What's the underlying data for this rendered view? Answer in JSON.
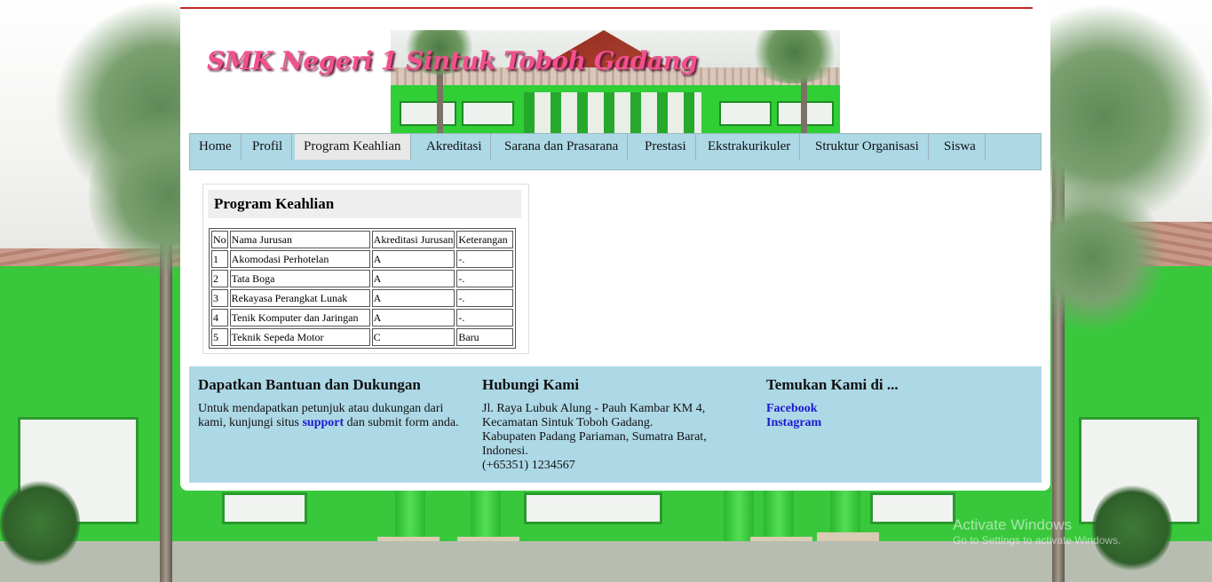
{
  "site": {
    "title": "SMK Negeri 1 Sintuk Toboh Gadang"
  },
  "nav": {
    "items": [
      {
        "label": "Home"
      },
      {
        "label": "Profil"
      },
      {
        "label": "Program Keahlian"
      },
      {
        "label": "Akreditasi"
      },
      {
        "label": "Sarana dan Prasarana"
      },
      {
        "label": "Prestasi"
      },
      {
        "label": "Ekstrakurikuler"
      },
      {
        "label": "Struktur Organisasi"
      },
      {
        "label": "Siswa"
      }
    ],
    "active": "Program Keahlian"
  },
  "content": {
    "heading": "Program Keahlian",
    "table": {
      "headers": [
        "No",
        "Nama Jurusan",
        "Akreditasi Jurusan",
        "Keterangan"
      ],
      "rows": [
        [
          "1",
          "Akomodasi Perhotelan",
          "A",
          "-."
        ],
        [
          "2",
          "Tata Boga",
          "A",
          "-."
        ],
        [
          "3",
          "Rekayasa Perangkat Lunak",
          "A",
          "-."
        ],
        [
          "4",
          "Tenik Komputer dan Jaringan",
          "A",
          "-."
        ],
        [
          "5",
          "Teknik Sepeda Motor",
          "C",
          "Baru"
        ]
      ]
    }
  },
  "footer": {
    "help": {
      "title": "Dapatkan Bantuan dan Dukungan",
      "text_before": "Untuk mendapatkan petunjuk atau dukungan dari kami, kunjungi situs",
      "link": "support",
      "text_after": "dan submit form anda."
    },
    "contact": {
      "title": "Hubungi Kami",
      "lines": [
        "Jl. Raya Lubuk Alung - Pauh Kambar KM 4,",
        "Kecamatan Sintuk Toboh Gadang.",
        "Kabupaten Padang Pariaman, Sumatra Barat,",
        "Indonesi.",
        "(+65351) 1234567"
      ]
    },
    "social": {
      "title": "Temukan Kami di ...",
      "links": [
        "Facebook",
        "Instagram"
      ]
    }
  },
  "os_watermark": {
    "line1": "Activate Windows",
    "line2": "Go to Settings to activate Windows."
  },
  "colors": {
    "nav_bg": "#add8e6",
    "title_pink": "#f2508f",
    "top_rule": "#c62828",
    "link": "#1a1ad0"
  }
}
